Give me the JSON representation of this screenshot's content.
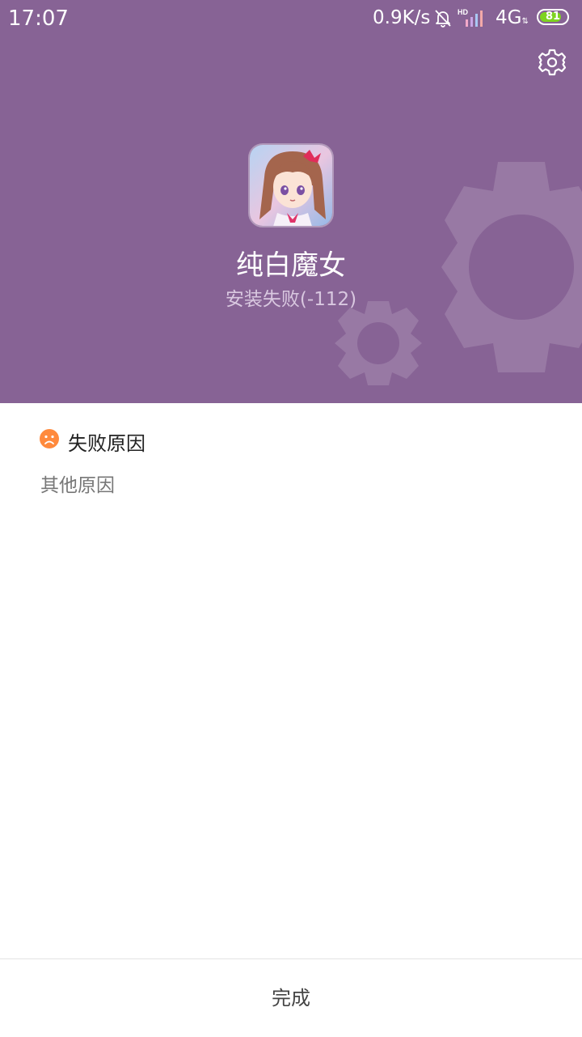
{
  "status_bar": {
    "time": "17:07",
    "speed": "0.9K/s",
    "signal_label": "HD",
    "network": "4G",
    "network_arrows": "⇅",
    "battery_percent": "81",
    "battery_level": 0.81,
    "icons": [
      "bell-muted-icon",
      "signal-bars-icon",
      "battery-icon"
    ]
  },
  "header": {
    "background_color": "#876395",
    "settings_icon": "gear-icon",
    "app_name": "纯白魔女",
    "status": "安装失败(-112)"
  },
  "failure": {
    "icon": "sad-face-icon",
    "icon_color": "#ff8a3d",
    "title": "失败原因",
    "reason": "其他原因"
  },
  "footer": {
    "done_label": "完成"
  }
}
